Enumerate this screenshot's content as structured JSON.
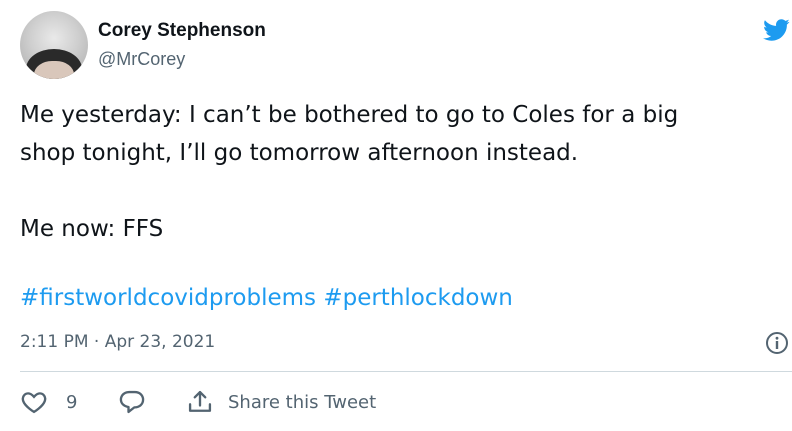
{
  "user": {
    "name": "Corey Stephenson",
    "handle": "@MrCorey"
  },
  "icons": {
    "brand": "twitter-bird-icon",
    "info": "info-icon",
    "like": "heart-icon",
    "reply": "reply-bubble-icon",
    "share": "share-upload-icon"
  },
  "tweet": {
    "lines": [
      "Me yesterday: I can’t be bothered to go to Coles for a big",
      "shop tonight, I’ll go tomorrow afternoon instead.",
      "Me now: FFS"
    ],
    "hashtags": [
      "#firstworldcovidproblems",
      "#perthlockdown"
    ],
    "timestamp": "2:11 PM · Apr 23, 2021"
  },
  "actions": {
    "like_count": "9",
    "share_label": "Share this Tweet"
  },
  "colors": {
    "brand": "#1d9bf0",
    "text": "#0f1419",
    "secondary": "#536471",
    "divider": "#cfd9de"
  }
}
